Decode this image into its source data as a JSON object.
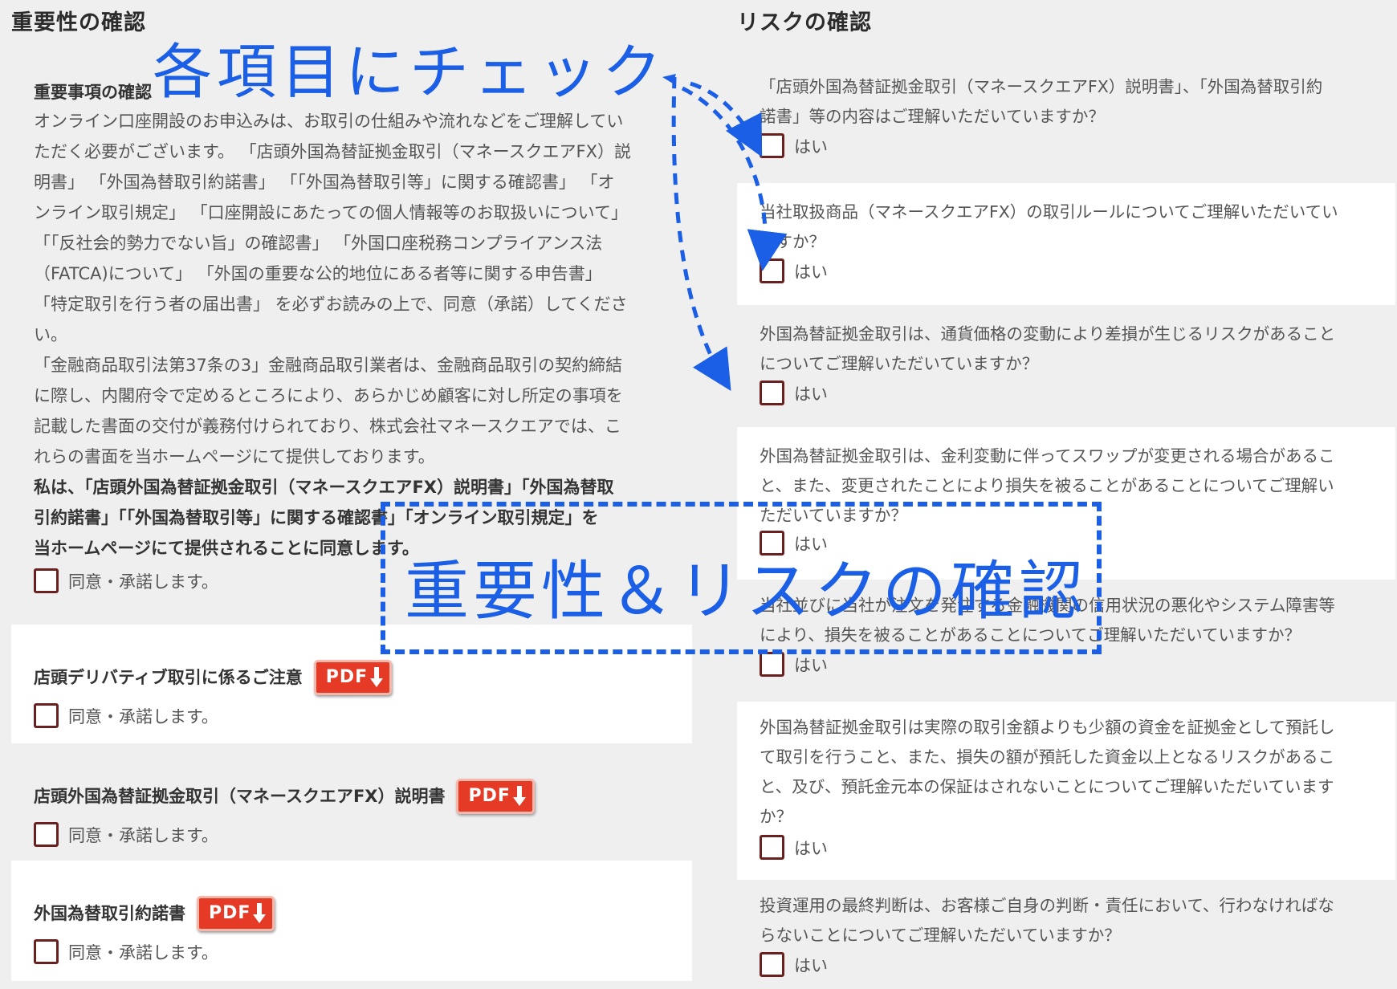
{
  "left": {
    "title": "重要性の確認",
    "sections": {
      "important": {
        "heading": "重要事項の確認",
        "paragraph_lines": [
          "オンライン口座開設のお申込みは、お取引の仕組みや流れなどをご理解してい",
          "ただく必要がございます。 「店頭外国為替証拠金取引（マネースクエアFX）説",
          "明書」 「外国為替取引約諾書」 「「外国為替取引等」に関する確認書」 「オ",
          "ンライン取引規定」 「口座開設にあたっての個人情報等のお取扱いについて」",
          "「「反社会的勢力でない旨」の確認書」 「外国口座税務コンプライアンス法",
          "（FATCA)について」 「外国の重要な公的地位にある者等に関する申告書」",
          "「特定取引を行う者の届出書」 を必ずお読みの上で、同意（承諾）してくださ",
          "い。",
          "「金融商品取引法第37条の3」金融商品取引業者は、金融商品取引の契約締結",
          "に際し、内閣府令で定めるところにより、あらかじめ顧客に対し所定の事項を",
          "記載した書面の交付が義務付けられており、株式会社マネースクエアでは、こ",
          "れらの書面を当ホームページにて提供しております。"
        ],
        "bold_lines": [
          "私は、「店頭外国為替証拠金取引（マネースクエアFX）説明書」「外国為替取",
          "引約諾書」「「外国為替取引等」に関する確認書」「オンライン取引規定」を",
          "当ホームページにて提供されることに同意します。"
        ],
        "check_label": "同意・承諾します。"
      },
      "derivative": {
        "heading": "店頭デリバティブ取引に係るご注意",
        "pdf": "PDF",
        "check_label": "同意・承諾します。"
      },
      "manual": {
        "heading": "店頭外国為替証拠金取引（マネースクエアFX）説明書",
        "pdf": "PDF",
        "check_label": "同意・承諾します。"
      },
      "agreement": {
        "heading": "外国為替取引約諾書",
        "pdf": "PDF",
        "check_label": "同意・承諾します。"
      }
    }
  },
  "right": {
    "title": "リスクの確認",
    "questions": [
      {
        "lines": [
          "「店頭外国為替証拠金取引（マネースクエアFX）説明書」、「外国為替取引約",
          "諾書」等の内容はご理解いただいていますか？"
        ],
        "check_label": "はい"
      },
      {
        "lines": [
          "当社取扱商品（マネースクエアFX）の取引ルールについてご理解いただいてい",
          "ますか？"
        ],
        "check_label": "はい"
      },
      {
        "lines": [
          "外国為替証拠金取引は、通貨価格の変動により差損が生じるリスクがあること",
          "についてご理解いただいていますか？"
        ],
        "check_label": "はい"
      },
      {
        "lines": [
          "外国為替証拠金取引は、金利変動に伴ってスワップが変更される場合があるこ",
          "と、また、変更されたことにより損失を被ることがあることについてご理解い",
          "ただいていますか？"
        ],
        "check_label": "はい"
      },
      {
        "lines": [
          "当社並びに当社が注文を発注する金融機関の信用状況の悪化やシステム障害等",
          "により、損失を被ることがあることについてご理解いただいていますか？"
        ],
        "check_label": "はい"
      },
      {
        "lines": [
          "外国為替証拠金取引は実際の取引金額よりも少額の資金を証拠金として預託し",
          "て取引を行うこと、また、損失の額が預託した資金以上となるリスクがあるこ",
          "と、及び、預託金元本の保証はされないことについてご理解いただいています",
          "か？"
        ],
        "check_label": "はい"
      },
      {
        "lines": [
          "投資運用の最終判断は、お客様ご自身の判断・責任において、行わなければな",
          "らないことについてご理解いただいていますか？"
        ],
        "check_label": "はい"
      }
    ]
  },
  "annotations": {
    "check_each": "各項目にチェック",
    "box_label": "重要性＆リスクの確認",
    "color": "#1a5fe6"
  }
}
